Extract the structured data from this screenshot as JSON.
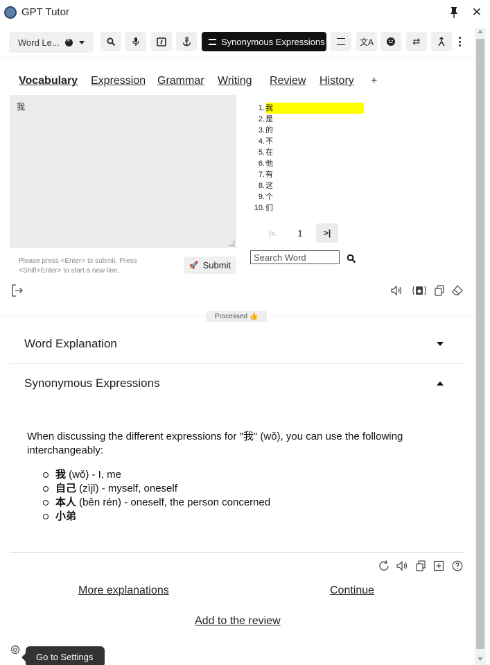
{
  "app": {
    "title": "GPT Tutor"
  },
  "toolbar": {
    "level_select": "Word Le...",
    "active_mode": "Synonymous Expressions"
  },
  "tabs": [
    "Vocabulary",
    "Expression",
    "Grammar",
    "Writing",
    "Review",
    "History",
    "+"
  ],
  "editor": {
    "value": "我",
    "hint": "Please press <Enter> to submit. Press <Shift+Enter> to start a new line.",
    "submit_label": "Submit"
  },
  "word_list": {
    "items": [
      {
        "num": "1.",
        "word": "我"
      },
      {
        "num": "2.",
        "word": "是"
      },
      {
        "num": "3.",
        "word": "的"
      },
      {
        "num": "4.",
        "word": "不"
      },
      {
        "num": "5.",
        "word": "在"
      },
      {
        "num": "6.",
        "word": "他"
      },
      {
        "num": "7.",
        "word": "有"
      },
      {
        "num": "8.",
        "word": "这"
      },
      {
        "num": "9.",
        "word": "个"
      },
      {
        "num": "10.",
        "word": "们"
      }
    ],
    "highlight_color": "#ffff00",
    "page": "1",
    "search_placeholder": "Search Word"
  },
  "status": {
    "processed": "Processed 👍"
  },
  "sections": {
    "word_explanation": "Word Explanation",
    "synonymous_expressions": "Synonymous Expressions"
  },
  "answer": {
    "intro": "When discussing the different expressions for \"我\" (wǒ), you can use the following interchangeably:",
    "items": [
      {
        "term": "我",
        "rest": " (wǒ) - I, me"
      },
      {
        "term": "自己",
        "rest": " (zìjǐ) - myself, oneself"
      },
      {
        "term": "本人",
        "rest": " (běn rén) - oneself, the person concerned"
      },
      {
        "term": "小弟",
        "rest": ""
      }
    ]
  },
  "links": {
    "more": "More explanations",
    "continue": "Continue",
    "review": "Add to the review"
  },
  "tooltip": {
    "settings": "Go to Settings"
  },
  "colors": {
    "active_button_bg": "#111111",
    "accent_highlight": "#ffff00"
  }
}
